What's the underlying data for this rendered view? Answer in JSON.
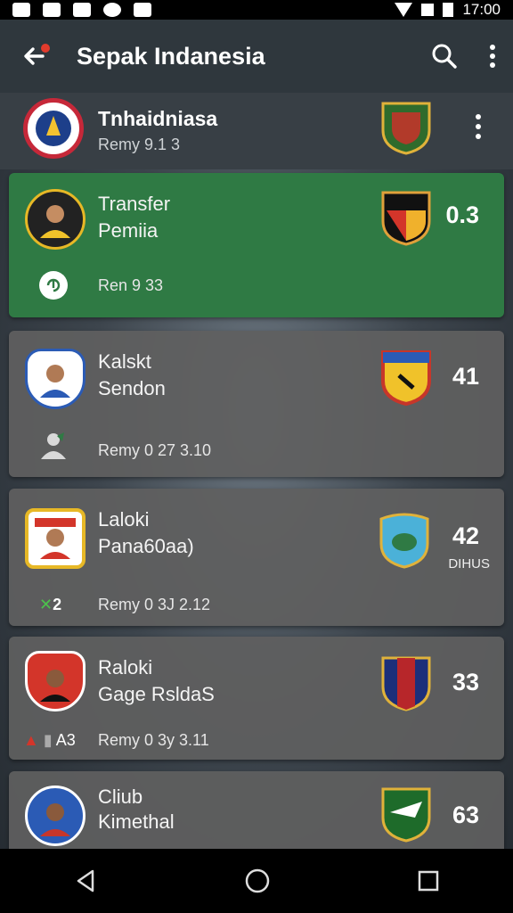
{
  "status": {
    "time": "17:00"
  },
  "appbar": {
    "title": "Sepak Indanesia"
  },
  "header_row": {
    "title": "Tnhaidniasa",
    "subtitle": "Remy 9.1 3"
  },
  "cards": [
    {
      "line1": "Transfer",
      "line2": "Pemiia",
      "score": "0.3",
      "sub": "Ren 9 33",
      "left_icon": "",
      "extra": ""
    },
    {
      "line1": "Kalskt",
      "line2": "Sendon",
      "score": "41",
      "sub": "Remy 0 27 3.10",
      "left_icon": "",
      "extra": ""
    },
    {
      "line1": "Laloki",
      "line2": "Pana60aa)",
      "score": "42",
      "sub": "Remy 0 3J 2.12",
      "left_icon": "2",
      "extra": "DIHUS"
    },
    {
      "line1": "Raloki",
      "line2": "Gage RsldaS",
      "score": "33",
      "sub": "Remy 0 3y 3.11",
      "left_icon": "A3",
      "extra": ""
    },
    {
      "line1": "Cliub",
      "line2": "Kimethal",
      "score": "63",
      "sub": "",
      "left_icon": "",
      "extra": ""
    }
  ],
  "colors": {
    "active_card": "#2f7a44",
    "card": "#606060",
    "appbar": "#2f373d"
  }
}
